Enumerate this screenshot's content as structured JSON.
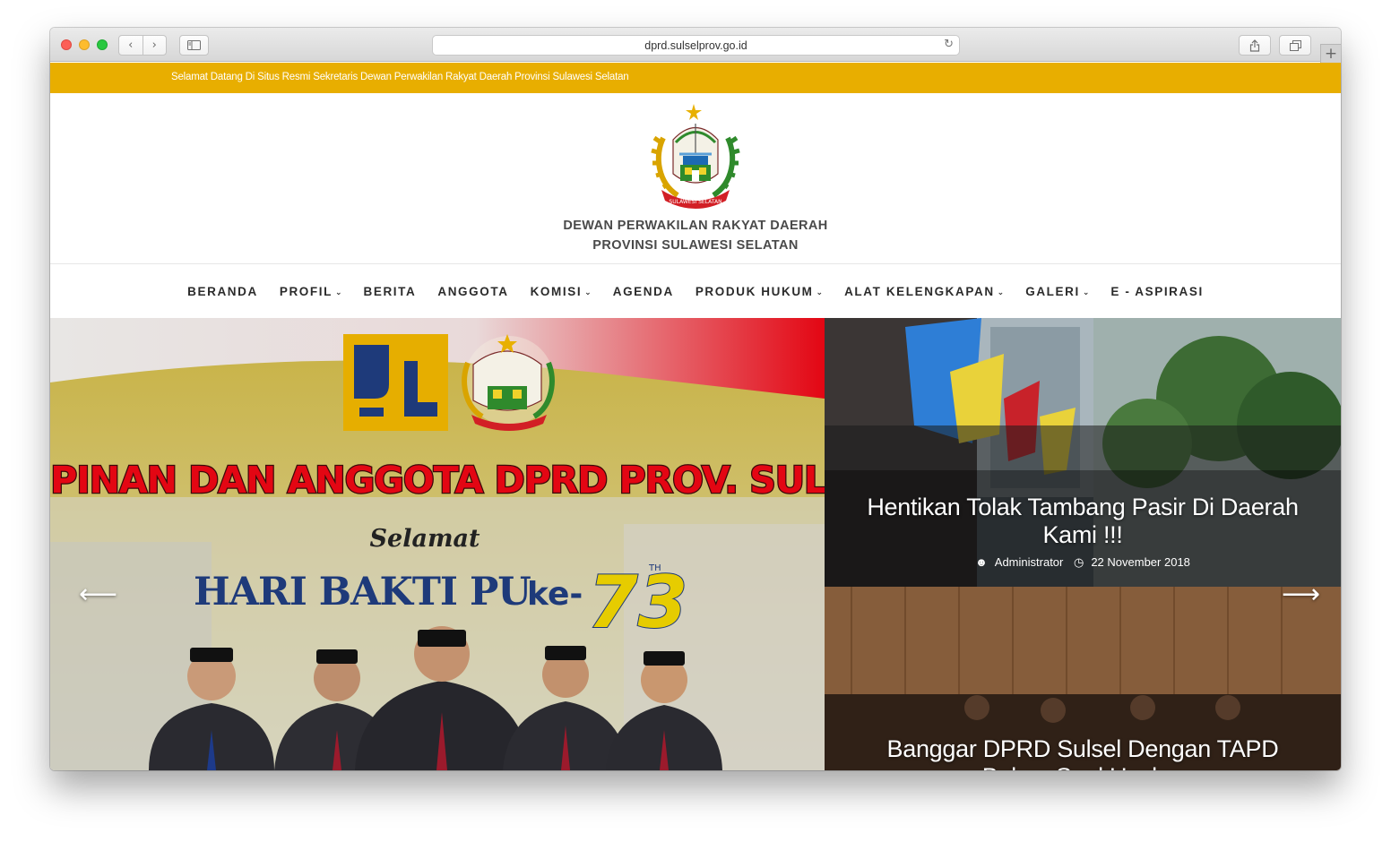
{
  "browser": {
    "url": "dprd.sulselprov.go.id",
    "back_icon": "chevron-left-icon",
    "forward_icon": "chevron-right-icon"
  },
  "topbar": {
    "welcome_text": "Selamat Datang Di Situs Resmi Sekretaris Dewan Perwakilan Rakyat Daerah Provinsi Sulawesi Selatan",
    "color": "#e8ae00"
  },
  "header": {
    "title_line1": "DEWAN PERWAKILAN RAKYAT DAERAH",
    "title_line2": "PROVINSI SULAWESI SELATAN",
    "logo_text": "SULAWESI SELATAN"
  },
  "menu": {
    "items": [
      {
        "label": "BERANDA",
        "dropdown": false
      },
      {
        "label": "PROFIL",
        "dropdown": true
      },
      {
        "label": "BERITA",
        "dropdown": false
      },
      {
        "label": "ANGGOTA",
        "dropdown": false
      },
      {
        "label": "KOMISI",
        "dropdown": true
      },
      {
        "label": "AGENDA",
        "dropdown": false
      },
      {
        "label": "PRODUK HUKUM",
        "dropdown": true
      },
      {
        "label": "ALAT KELENGKAPAN",
        "dropdown": true
      },
      {
        "label": "GALERI",
        "dropdown": true
      },
      {
        "label": "E - ASPIRASI",
        "dropdown": false
      }
    ]
  },
  "hero": {
    "banner_headline": "PIMPINAN DAN ANGGOTA DPRD PROV. SULSEL",
    "banner_greeting": "Selamat",
    "banner_event": "HARI BAKTI PU",
    "banner_ke": "ke-",
    "banner_number": "73",
    "banner_th": "TH"
  },
  "posts": [
    {
      "title": "Hentikan Tolak Tambang Pasir Di Daerah Kami !!!",
      "author": "Administrator",
      "date": "22 November 2018"
    },
    {
      "title": "Banggar DPRD Sulsel Dengan TAPD Bahas Soal Usulan"
    }
  ],
  "slider": {
    "prev_icon": "arrow-left-icon",
    "next_icon": "arrow-right-icon"
  }
}
